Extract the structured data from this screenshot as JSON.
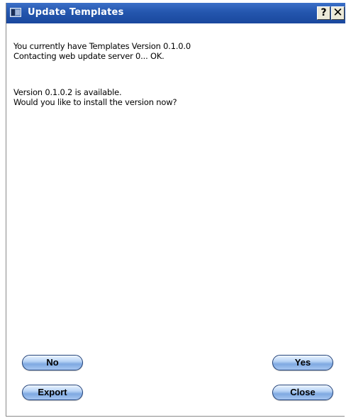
{
  "window": {
    "title": "Update Templates",
    "help_label": "?",
    "close_label": "✕"
  },
  "message": {
    "line1": "You currently have Templates Version 0.1.0.0",
    "line2": "Contacting web update server 0... OK.",
    "line3": "Version 0.1.0.2 is available.",
    "line4": "Would you like to install the version now?"
  },
  "buttons": {
    "no": "No",
    "yes": "Yes",
    "export": "Export",
    "close": "Close"
  }
}
